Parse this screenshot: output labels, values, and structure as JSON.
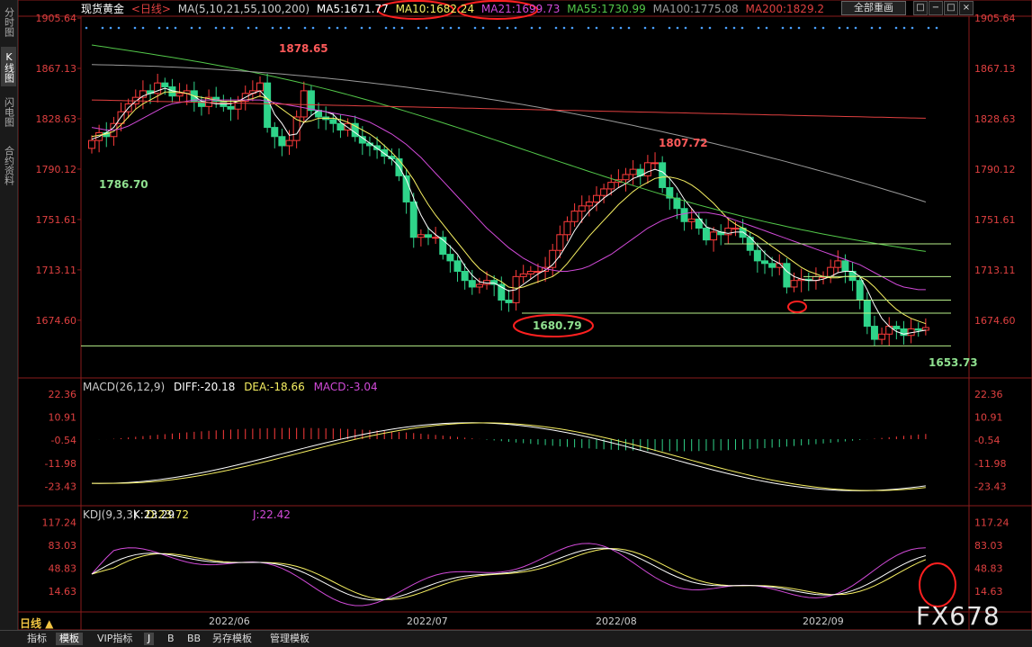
{
  "sidebar": {
    "tabs": [
      {
        "label": "分时图",
        "active": false
      },
      {
        "label": "K线图",
        "active": true
      },
      {
        "label": "闪电图",
        "active": false
      },
      {
        "label": "合约资料",
        "active": false
      }
    ]
  },
  "header": {
    "instrument": "现货黄金",
    "period_link": "<日线>",
    "ma_params": "MA(5,10,21,55,100,200)",
    "ma5": "MA5:1671.77",
    "ma10": "MA10:1682.24",
    "ma21": "MA21:1699.73",
    "ma55": "MA55:1730.99",
    "ma100": "MA100:1775.08",
    "ma200": "MA200:1829.2",
    "template_select": "全部重画",
    "window_btns": [
      "□",
      "−",
      "□",
      "×"
    ]
  },
  "colors": {
    "up": "#ff3c3c",
    "down": "#2fd48a",
    "ma5": "#ffffff",
    "ma10": "#f7f062",
    "ma21": "#d14ad8",
    "ma55": "#53c84a",
    "ma100": "#9a9a9a",
    "ma200": "#e04040",
    "axis_text": "#e04040",
    "hline": "#b8f08a"
  },
  "price_axis": {
    "ticks": [
      "1905.64",
      "1867.13",
      "1828.63",
      "1790.12",
      "1751.61",
      "1713.11",
      "1674.60"
    ]
  },
  "annotations": {
    "high1": "1878.65",
    "low1": "1786.70",
    "low2": "1680.79",
    "high2": "1807.72",
    "low3": "1653.73"
  },
  "macd": {
    "label": "MACD(26,12,9)",
    "diff": "DIFF:-20.18",
    "dea": "DEA:-18.66",
    "macd": "MACD:-3.04",
    "ticks": [
      "22.36",
      "10.91",
      "-0.54",
      "-11.98",
      "-23.43"
    ]
  },
  "kdj": {
    "label": "KDJ(9,3,3)",
    "k": "K:23.29",
    "d": "D:23.72",
    "j": "J:22.42",
    "ticks": [
      "117.24",
      "83.03",
      "48.83",
      "14.63"
    ]
  },
  "date_axis": [
    "2022/06",
    "2022/07",
    "2022/08",
    "2022/09"
  ],
  "period_label": "日线 ▲",
  "bottom_tabs": [
    {
      "label": "指标",
      "active": false
    },
    {
      "label": "模板",
      "active": true
    },
    {
      "label": "VIP指标",
      "active": false
    },
    {
      "label": "J",
      "active": true
    },
    {
      "label": "B",
      "active": false
    },
    {
      "label": "BB",
      "active": false
    },
    {
      "label": "另存模板",
      "active": false
    },
    {
      "label": "管理模板",
      "active": false
    }
  ],
  "watermark": "FX678",
  "chart_data": {
    "type": "candlestick",
    "closes": [
      1812,
      1818,
      1815,
      1825,
      1834,
      1840,
      1845,
      1850,
      1848,
      1856,
      1853,
      1846,
      1848,
      1850,
      1842,
      1838,
      1845,
      1842,
      1838,
      1836,
      1842,
      1848,
      1850,
      1856,
      1822,
      1815,
      1808,
      1812,
      1830,
      1850,
      1835,
      1830,
      1828,
      1825,
      1820,
      1825,
      1815,
      1810,
      1808,
      1805,
      1800,
      1798,
      1785,
      1765,
      1738,
      1740,
      1738,
      1738,
      1725,
      1720,
      1712,
      1705,
      1700,
      1702,
      1705,
      1702,
      1690,
      1688,
      1708,
      1710,
      1712,
      1712,
      1715,
      1728,
      1740,
      1750,
      1758,
      1762,
      1765,
      1770,
      1775,
      1780,
      1782,
      1786,
      1790,
      1785,
      1795,
      1795,
      1776,
      1768,
      1760,
      1750,
      1752,
      1745,
      1736,
      1742,
      1740,
      1745,
      1745,
      1738,
      1728,
      1720,
      1718,
      1715,
      1718,
      1700,
      1705,
      1706,
      1705,
      1708,
      1708,
      1715,
      1720,
      1712,
      1705,
      1690,
      1670,
      1660,
      1664,
      1670,
      1668,
      1663,
      1668,
      1667,
      1669
    ],
    "ma5": [
      1813,
      1815,
      1818,
      1822,
      1830,
      1837,
      1842,
      1846,
      1848,
      1850,
      1852,
      1850,
      1849,
      1848,
      1846,
      1842,
      1841,
      1840,
      1840,
      1840,
      1842,
      1845,
      1848,
      1850,
      1844,
      1832,
      1825,
      1816,
      1817,
      1826,
      1831,
      1835,
      1834,
      1832,
      1826,
      1822,
      1818,
      1814,
      1810,
      1806,
      1802,
      1798,
      1792,
      1782,
      1768,
      1755,
      1745,
      1740,
      1736,
      1731,
      1725,
      1716,
      1709,
      1704,
      1703,
      1703,
      1700,
      1697,
      1698,
      1702,
      1706,
      1710,
      1713,
      1717,
      1724,
      1733,
      1743,
      1751,
      1758,
      1763,
      1768,
      1772,
      1776,
      1779,
      1783,
      1785,
      1788,
      1790,
      1788,
      1783,
      1776,
      1767,
      1760,
      1753,
      1746,
      1744,
      1742,
      1741,
      1742,
      1742,
      1738,
      1732,
      1726,
      1721,
      1718,
      1712,
      1708,
      1706,
      1705,
      1705,
      1706,
      1708,
      1711,
      1712,
      1712,
      1708,
      1698,
      1686,
      1676,
      1670,
      1666,
      1664,
      1665,
      1666,
      1667
    ],
    "ma10": [
      1815,
      1816,
      1817,
      1819,
      1824,
      1830,
      1836,
      1840,
      1843,
      1846,
      1849,
      1849,
      1849,
      1848,
      1846,
      1845,
      1844,
      1843,
      1842,
      1842,
      1842,
      1843,
      1844,
      1846,
      1844,
      1840,
      1836,
      1832,
      1828,
      1826,
      1827,
      1829,
      1829,
      1829,
      1828,
      1826,
      1823,
      1820,
      1817,
      1813,
      1808,
      1803,
      1797,
      1790,
      1782,
      1772,
      1763,
      1755,
      1748,
      1741,
      1734,
      1727,
      1720,
      1714,
      1710,
      1707,
      1704,
      1700,
      1699,
      1700,
      1702,
      1704,
      1706,
      1708,
      1712,
      1718,
      1725,
      1732,
      1739,
      1745,
      1751,
      1757,
      1763,
      1768,
      1773,
      1777,
      1780,
      1783,
      1784,
      1784,
      1783,
      1781,
      1778,
      1774,
      1769,
      1764,
      1758,
      1752,
      1748,
      1745,
      1742,
      1739,
      1735,
      1731,
      1727,
      1723,
      1719,
      1715,
      1712,
      1710,
      1708,
      1707,
      1707,
      1708,
      1708,
      1708,
      1705,
      1700,
      1694,
      1688,
      1683,
      1679,
      1676,
      1674,
      1672
    ],
    "ma21": [
      1822,
      1821,
      1820,
      1820,
      1821,
      1823,
      1826,
      1829,
      1832,
      1835,
      1838,
      1840,
      1841,
      1842,
      1843,
      1843,
      1843,
      1843,
      1843,
      1843,
      1843,
      1843,
      1843,
      1843,
      1842,
      1841,
      1840,
      1839,
      1838,
      1837,
      1836,
      1835,
      1834,
      1833,
      1832,
      1831,
      1830,
      1828,
      1826,
      1823,
      1820,
      1817,
      1813,
      1809,
      1804,
      1799,
      1793,
      1787,
      1781,
      1775,
      1769,
      1763,
      1757,
      1751,
      1745,
      1740,
      1735,
      1730,
      1726,
      1722,
      1719,
      1716,
      1714,
      1713,
      1712,
      1712,
      1713,
      1714,
      1716,
      1719,
      1722,
      1725,
      1729,
      1733,
      1737,
      1741,
      1745,
      1748,
      1751,
      1753,
      1755,
      1756,
      1757,
      1757,
      1757,
      1756,
      1755,
      1753,
      1751,
      1749,
      1747,
      1745,
      1743,
      1741,
      1739,
      1737,
      1735,
      1733,
      1731,
      1729,
      1727,
      1725,
      1723,
      1721,
      1719,
      1717,
      1714,
      1711,
      1708,
      1705,
      1702,
      1700,
      1699,
      1698,
      1698
    ]
  }
}
